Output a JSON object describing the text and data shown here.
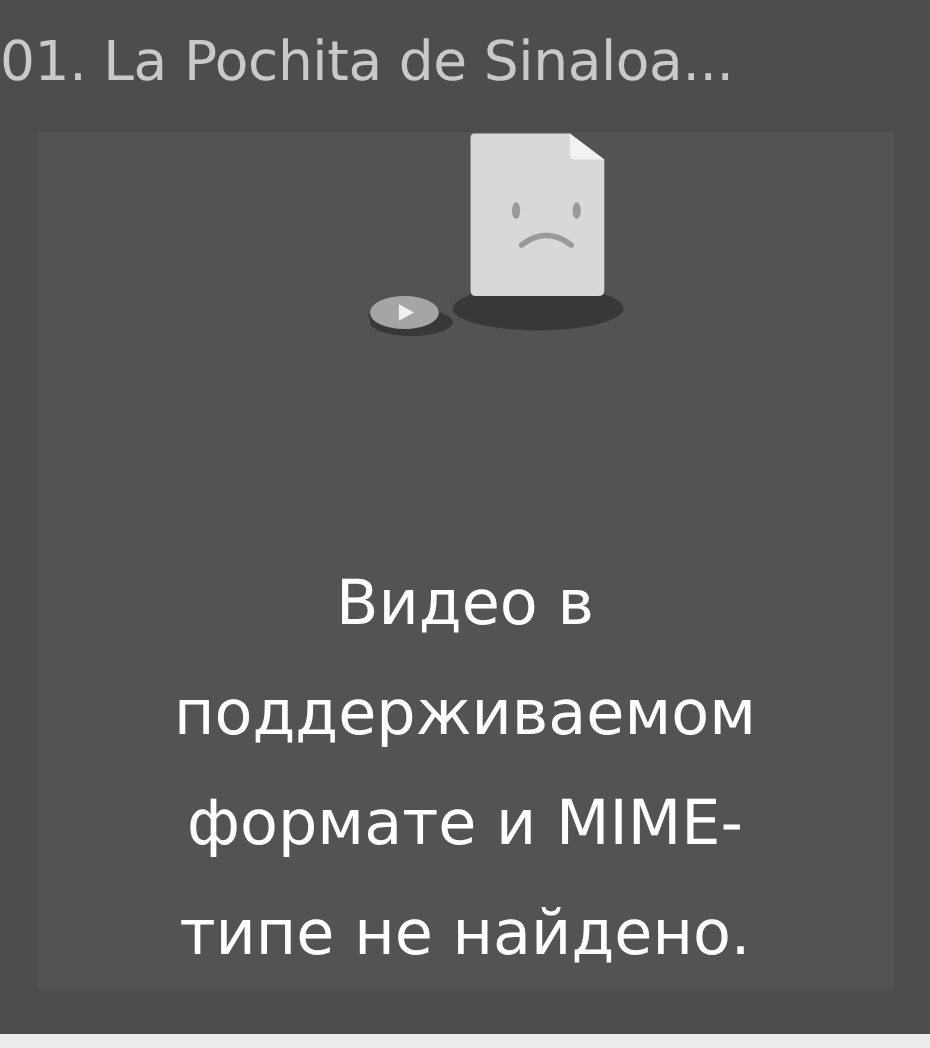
{
  "title": "01. La Pochita de Sinaloa...",
  "player": {
    "message": "Видео в поддерживаемом формате и MIME-типе не найдено."
  }
}
